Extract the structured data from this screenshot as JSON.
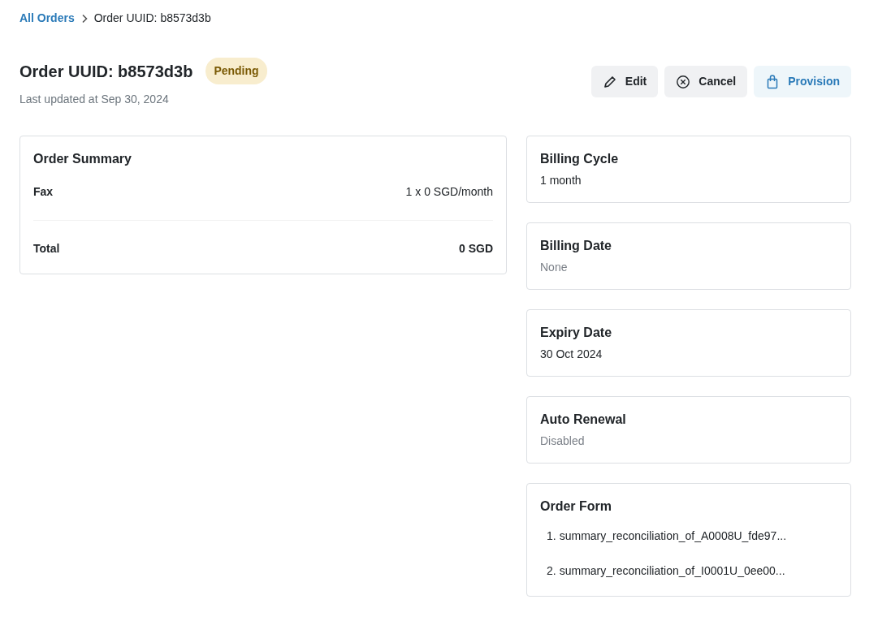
{
  "breadcrumb": {
    "items": [
      {
        "label": "All Orders",
        "kind": "link"
      },
      {
        "label": "Order UUID: b8573d3b",
        "kind": "current"
      }
    ]
  },
  "header": {
    "title": "Order UUID: b8573d3b",
    "status": {
      "label": "Pending",
      "color": "#f8edce"
    },
    "subtitle": "Last updated at Sep 30, 2024"
  },
  "actions": [
    {
      "label": "Edit",
      "kind": "edit"
    },
    {
      "label": "Cancel",
      "kind": "cancel"
    },
    {
      "label": "Provision",
      "kind": "provision"
    }
  ],
  "order_summary": {
    "title": "Order Summary",
    "lines": [
      {
        "name": "Fax",
        "amount": "1 x 0 SGD/month"
      }
    ],
    "total": {
      "label": "Total",
      "amount": "0 SGD"
    }
  },
  "details": [
    {
      "title": "Billing Cycle",
      "value": "1 month",
      "muted": false
    },
    {
      "title": "Billing Date",
      "value": "None",
      "muted": true
    },
    {
      "title": "Expiry Date",
      "value": "30 Oct 2024",
      "muted": false
    },
    {
      "title": "Auto Renewal",
      "value": "Disabled",
      "muted": true
    }
  ],
  "order_form": {
    "title": "Order Form",
    "files": [
      {
        "number": "1.",
        "name": "summary_reconciliation_of_A0008U_fde97..."
      },
      {
        "number": "2.",
        "name": "summary_reconciliation_of_I0001U_0ee00..."
      }
    ]
  }
}
